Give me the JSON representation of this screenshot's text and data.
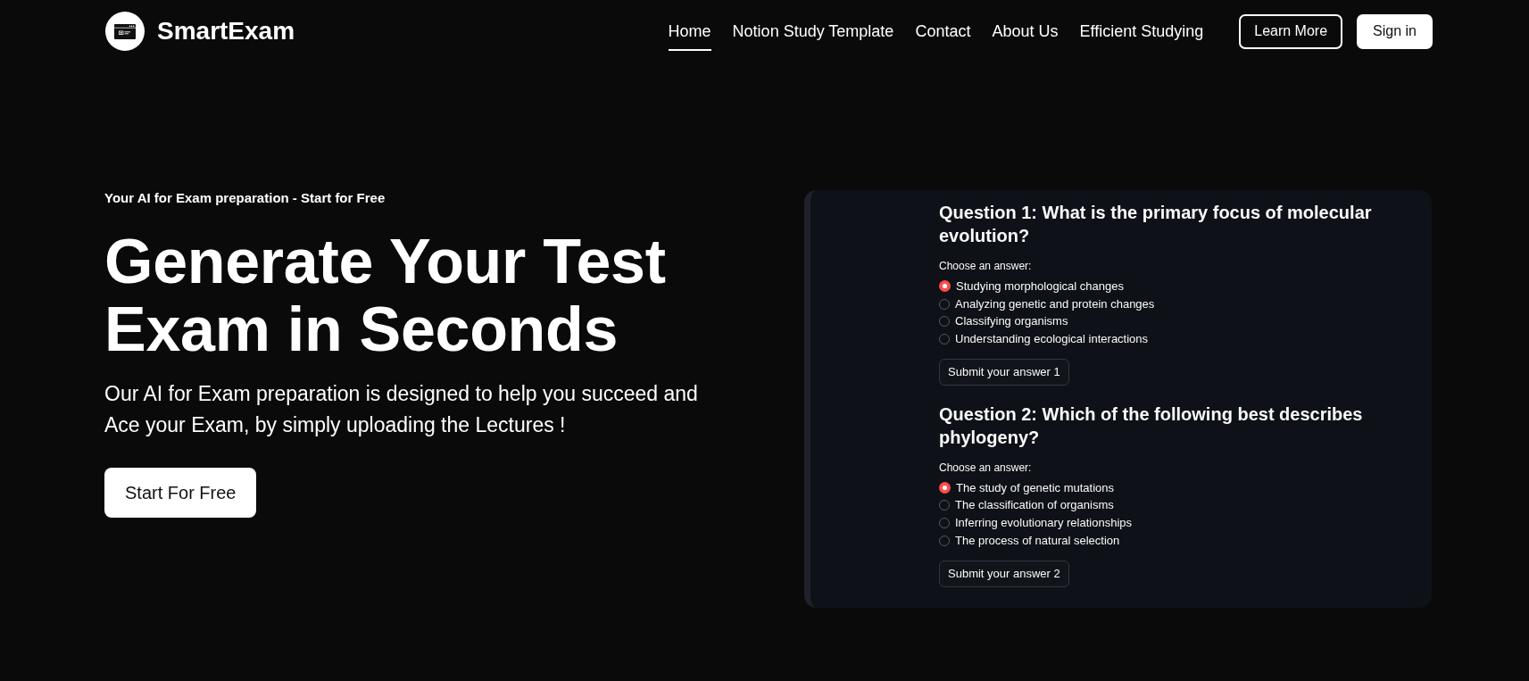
{
  "header": {
    "brand": "SmartExam",
    "nav": [
      {
        "label": "Home",
        "selected": true
      },
      {
        "label": "Notion Study Template",
        "selected": false
      },
      {
        "label": "Contact",
        "selected": false
      },
      {
        "label": "About Us",
        "selected": false
      },
      {
        "label": "Efficient Studying",
        "selected": false
      }
    ],
    "buttons": [
      {
        "label": "Learn More",
        "kind": "outline"
      },
      {
        "label": "Sign in",
        "kind": "solid"
      }
    ]
  },
  "hero": {
    "tagline": "Your AI for Exam preparation - Start for Free",
    "heading": "Generate Your Test Exam in Seconds",
    "description": "Our AI for Exam preparation is designed to help you succeed and Ace your Exam, by simply uploading the Lectures !",
    "button": "Start For Free"
  },
  "quiz": {
    "questions": [
      {
        "title": "Question 1: What is the primary focus of molecular evolution?",
        "prompt": "Choose an answer:",
        "options": [
          {
            "label": "Studying morphological changes",
            "selected": true
          },
          {
            "label": "Analyzing genetic and protein changes",
            "selected": false
          },
          {
            "label": "Classifying organisms",
            "selected": false
          },
          {
            "label": "Understanding ecological interactions",
            "selected": false
          }
        ],
        "submit": "Submit your answer 1"
      },
      {
        "title": "Question 2: Which of the following best describes phylogeny?",
        "prompt": "Choose an answer:",
        "options": [
          {
            "label": "The study of genetic mutations",
            "selected": true
          },
          {
            "label": "The classification of organisms",
            "selected": false
          },
          {
            "label": "Inferring evolutionary relationships",
            "selected": false
          },
          {
            "label": "The process of natural selection",
            "selected": false
          }
        ],
        "submit": "Submit your answer 2"
      }
    ]
  }
}
